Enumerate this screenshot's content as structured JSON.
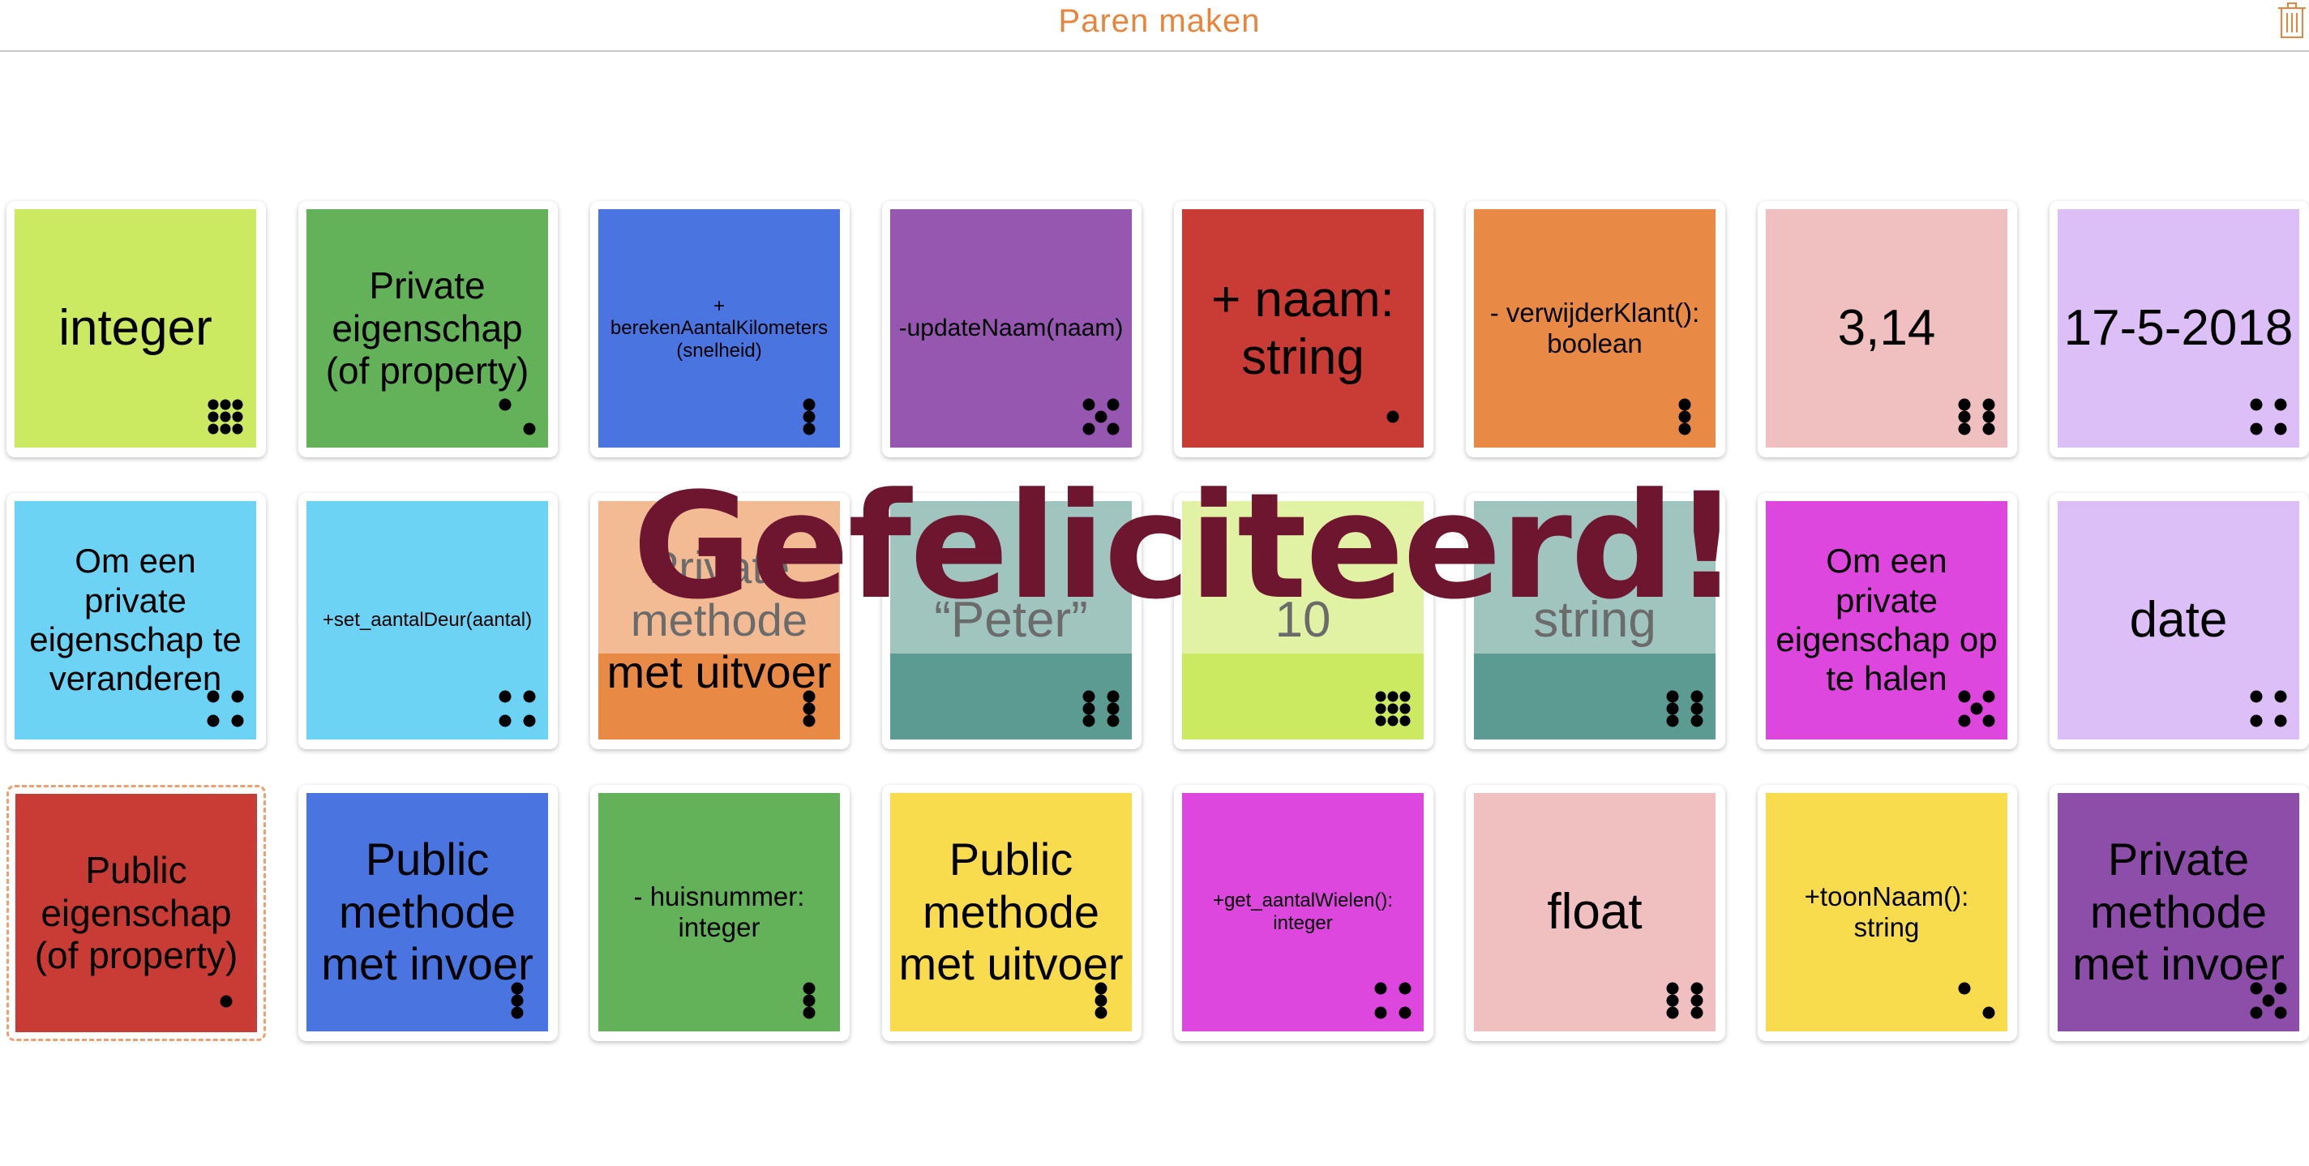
{
  "header": {
    "title": "Paren maken",
    "trash_icon": "trash-icon"
  },
  "congrats_text": "Gefeliciteerd!",
  "colors": {
    "title": "#e8853c",
    "congrats": "#6e1530",
    "lime": "#cce962",
    "green": "#63b158",
    "blue": "#4a75e0",
    "purple": "#9557b0",
    "red": "#c93b35",
    "orange": "#e88a45",
    "pink": "#f0bfbf",
    "lavender": "#dcbff6",
    "skyblue": "#6cd3f4",
    "teal": "#5c9b91",
    "magenta": "#dd47dd",
    "yellow": "#f8dc4e",
    "violet": "#8c4ea8"
  },
  "cards": [
    {
      "text": "integer",
      "color": "#cce962",
      "dice": 9,
      "size": "l",
      "matched": false,
      "selected": false
    },
    {
      "text": "Private eigenschap (of property)",
      "color": "#63b158",
      "dice": 2,
      "size": "m",
      "matched": false,
      "selected": false
    },
    {
      "text": "+ berekenAantalKilometers (snelheid)",
      "color": "#4a75e0",
      "dice": 3,
      "size": "s",
      "matched": false,
      "selected": false
    },
    {
      "text": "-updateNaam(naam)",
      "color": "#9557b0",
      "dice": 5,
      "size": "sm",
      "matched": false,
      "selected": false
    },
    {
      "text": "+ naam: string",
      "color": "#c93b35",
      "dice": 1,
      "size": "l",
      "matched": false,
      "selected": false
    },
    {
      "text": "- verwijderKlant(): boolean",
      "color": "#e88a45",
      "dice": 3,
      "size": "s2",
      "matched": false,
      "selected": false
    },
    {
      "text": "3,14",
      "color": "#f0bfbf",
      "dice": 6,
      "size": "l",
      "matched": false,
      "selected": false
    },
    {
      "text": "17-5-2018",
      "color": "#dcbff6",
      "dice": 4,
      "size": "l",
      "matched": false,
      "selected": false
    },
    {
      "text": "Om een private eigenschap te veranderen",
      "color": "#6cd3f4",
      "dice": 4,
      "size": "m2",
      "matched": false,
      "selected": false
    },
    {
      "text": "+set_aantalDeur(aantal)",
      "color": "#6cd3f4",
      "dice": 4,
      "size": "s",
      "matched": false,
      "selected": false
    },
    {
      "text": "Private methode met uitvoer",
      "color": "#e88a45",
      "dice": 3,
      "size": "l2",
      "matched": true,
      "selected": false
    },
    {
      "text": "“Peter”",
      "color": "#5c9b91",
      "dice": 6,
      "size": "l",
      "matched": true,
      "selected": false
    },
    {
      "text": "10",
      "color": "#cce962",
      "dice": 9,
      "size": "l",
      "matched": true,
      "selected": false
    },
    {
      "text": "string",
      "color": "#5c9b91",
      "dice": 6,
      "size": "l",
      "matched": true,
      "selected": false
    },
    {
      "text": "Om een private eigenschap op te halen",
      "color": "#dd47dd",
      "dice": 5,
      "size": "m2",
      "matched": false,
      "selected": false
    },
    {
      "text": "date",
      "color": "#dcbff6",
      "dice": 4,
      "size": "l",
      "matched": false,
      "selected": false
    },
    {
      "text": "Public eigenschap (of property)",
      "color": "#c93b35",
      "dice": 1,
      "size": "m",
      "matched": false,
      "selected": true
    },
    {
      "text": "Public methode met invoer",
      "color": "#4a75e0",
      "dice": 3,
      "size": "l2",
      "matched": false,
      "selected": false
    },
    {
      "text": "- huisnummer: integer",
      "color": "#63b158",
      "dice": 3,
      "size": "s2",
      "matched": false,
      "selected": false
    },
    {
      "text": "Public methode met uitvoer",
      "color": "#f8dc4e",
      "dice": 3,
      "size": "l2",
      "matched": false,
      "selected": false
    },
    {
      "text": "+get_aantalWielen(): integer",
      "color": "#dd47dd",
      "dice": 4,
      "size": "s",
      "matched": false,
      "selected": false
    },
    {
      "text": "float",
      "color": "#f0bfbf",
      "dice": 6,
      "size": "l",
      "matched": false,
      "selected": false
    },
    {
      "text": "+toonNaam(): string",
      "color": "#f8dc4e",
      "dice": 2,
      "size": "s2",
      "matched": false,
      "selected": false
    },
    {
      "text": "Private methode met invoer",
      "color": "#8c4ea8",
      "dice": 5,
      "size": "l2",
      "matched": false,
      "selected": false
    }
  ]
}
